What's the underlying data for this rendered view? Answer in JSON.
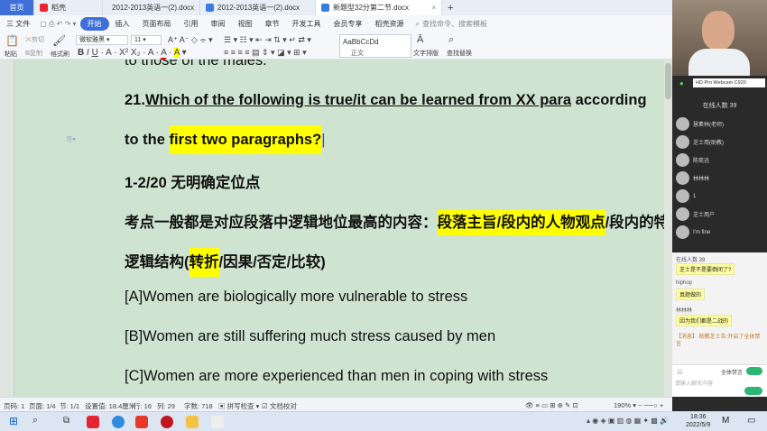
{
  "tabs": [
    {
      "label": "首页"
    },
    {
      "label": "稻壳"
    },
    {
      "label": "2012-2013英语一(2).docx"
    },
    {
      "label": "2012-2013英语一(2).docx"
    },
    {
      "label": "新题型32分第二节.docx"
    }
  ],
  "new_tab": "+",
  "menu": {
    "file": "三 文件",
    "items": [
      "开始",
      "插入",
      "页面布局",
      "引用",
      "审阅",
      "视图",
      "章节",
      "开发工具",
      "会员专享",
      "稻壳资源"
    ],
    "search": "查找命令、搜索模板"
  },
  "toolbar": {
    "paste": "粘贴",
    "cut": "剪切",
    "copy": "复制",
    "format_painter": "格式刷",
    "font": "微软雅黑",
    "size": "11",
    "style_sample": "AaBbCcDd",
    "style_name": "正文",
    "text_layout": "文字排版",
    "find_replace": "查找替换"
  },
  "doc": {
    "line0": "to those of the males.",
    "q_num": "21.",
    "q_part1": "Which of the following is true/it can be learned from XX para",
    "q_part2": " according",
    "q2_a": "to the ",
    "q2_hl": "first two paragraphs?",
    "line3": "1-2/20     无明确定位点",
    "l4_a": "考点一般都是对应段落中逻辑地位最高的内容：",
    "l4_hl": "段落主旨/段内的人物观点",
    "l4_b": "/段内的特殊",
    "l5_a": "逻辑结构(",
    "l5_hl": "转折",
    "l5_b": "/因果/否定/比较)",
    "optA": "[A]Women are biologically more vulnerable to stress",
    "optB": "[B]Women are still suffering much stress caused by men",
    "optC": "[C]Women are more experienced than men in coping with stress"
  },
  "status": {
    "page": "页码: 1",
    "pages": "页面: 1/4",
    "section": "节: 1/1",
    "setting": "设置值: 18.4厘米",
    "row": "行: 16",
    "col": "列: 29",
    "words": "字数: 718",
    "spell": "拼写检查",
    "proof": "文档校对",
    "zoom": "190%"
  },
  "clock": {
    "time": "18:36",
    "date": "2022/5/9"
  },
  "panel": {
    "camera": "HD Pro Webcam C920",
    "online": "在线人数 39",
    "users": [
      "慧素林(老师)",
      "芝士用(助教)",
      "陈奕迅",
      "林林林",
      "1",
      "芝士用户",
      "I'm fine"
    ],
    "chat": [
      {
        "name": "在线人数 39",
        "msg": "芝士是不是要倒闭了?"
      },
      {
        "name": "hiphop",
        "msg": "真题做的"
      },
      {
        "name": "林林林",
        "msg": "因为我们都是二战的"
      }
    ],
    "notice": "【消息】 助教芝士告:开启了全体禁言",
    "input_placeholder": "请输入聊天内容",
    "mute_label": "全体禁言"
  },
  "colors": {
    "accent": "#3e6fd8",
    "doc_bg": "#cfe4d0",
    "highlight": "#ffff00"
  }
}
